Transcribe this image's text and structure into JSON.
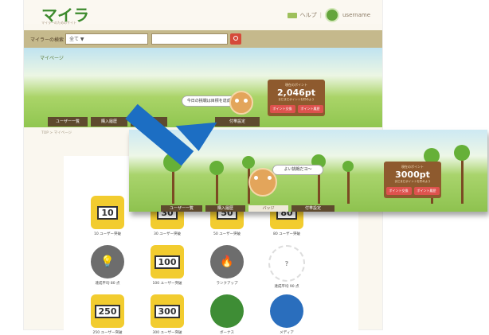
{
  "header": {
    "logo": "マイラ",
    "logo_sub": "マイラーのためのサイト",
    "link_label": "ヘルプ",
    "username": "username"
  },
  "search": {
    "label": "マイラーの検索",
    "select_value": "全て ▼",
    "input_value": "",
    "button_label": "検索"
  },
  "page_title": "マイページ",
  "breadcrumb": "TOP > マイページ",
  "hero": {
    "bubble_text": "今日の挑戦は目標を達成できる?",
    "points_label": "現在のポイント",
    "points_value": "2,046pt",
    "points_note": "まだまだポイントを貯めよう",
    "btn_exchange": "ポイント交換",
    "btn_history": "ポイント履歴"
  },
  "tabs": [
    "ユーザー一覧",
    "購入履歴",
    "バッジ",
    "付帯設定"
  ],
  "overlay": {
    "bubble_text": "よい挑戦だヨ〜",
    "points_label": "現在のポイント",
    "points_value": "3000pt",
    "points_note": "まだまだポイントを貯めよう",
    "btn_exchange": "ポイント交換",
    "btn_history": "ポイント履歴",
    "tabs": [
      "ユーザー一覧",
      "購入履歴",
      "バッジ",
      "付帯設定"
    ]
  },
  "badges": [
    {
      "label": "10 ユーザー突破",
      "value": "10",
      "style": "yellow"
    },
    {
      "label": "30 ユーザー突破",
      "value": "30",
      "style": "yellow"
    },
    {
      "label": "50 ユーザー突破",
      "value": "50",
      "style": "yellow"
    },
    {
      "label": "80 ユーザー突破",
      "value": "80",
      "style": "yellow"
    },
    {
      "label": "達成平均 80 点",
      "value": "",
      "style": "gray",
      "icon": "lightbulb-icon"
    },
    {
      "label": "100 ユーザー突破",
      "value": "100",
      "style": "yellow"
    },
    {
      "label": "ランクアップ",
      "value": "",
      "style": "gray",
      "icon": "flame-icon"
    },
    {
      "label": "達成平均 90 点",
      "value": "?",
      "style": "outline"
    },
    {
      "label": "250 ユーザー突破",
      "value": "250",
      "style": "yellow"
    },
    {
      "label": "300 ユーザー突破",
      "value": "300",
      "style": "yellow"
    },
    {
      "label": "ボーナス",
      "value": "",
      "style": "green",
      "icon": "briefcase-icon"
    },
    {
      "label": "メディア",
      "value": "",
      "style": "blue",
      "icon": "tv-icon"
    }
  ],
  "colors": {
    "accent_green": "#3d8a2e",
    "search_bar": "#c5b98c",
    "tab_bg": "#5e4a2e",
    "signpost": "#8e5a2e",
    "button_red": "#de524e",
    "arrow_blue": "#1c6ec3"
  }
}
